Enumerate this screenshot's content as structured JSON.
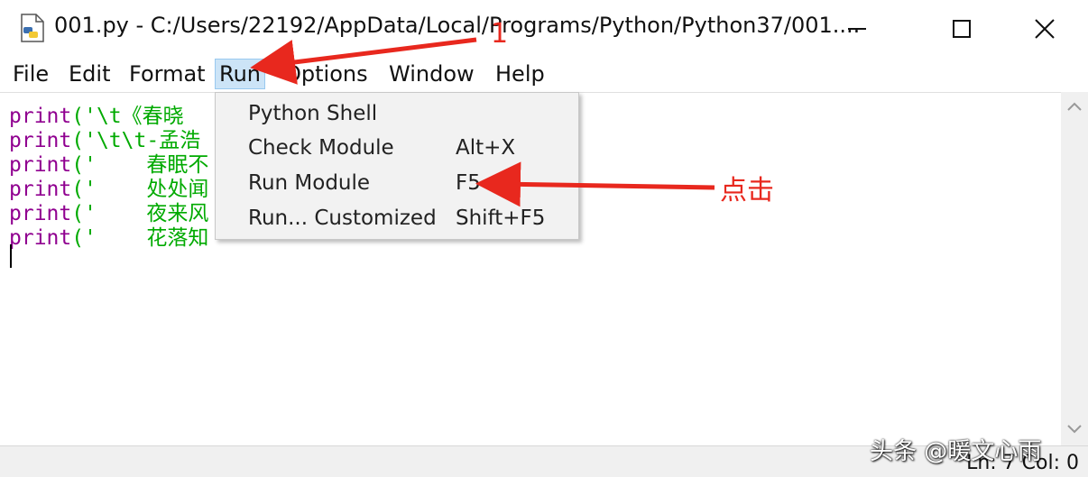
{
  "window": {
    "title": "001.py - C:/Users/22192/AppData/Local/Programs/Python/Python37/001....",
    "controls": {
      "minimize": "minimize-icon",
      "maximize": "maximize-icon",
      "close": "close-icon"
    }
  },
  "menubar": {
    "items": [
      "File",
      "Edit",
      "Format",
      "Run",
      "Options",
      "Window",
      "Help"
    ],
    "active": "Run"
  },
  "editor": {
    "lines": [
      {
        "keyword": "print",
        "text": "('\\t《春晓"
      },
      {
        "keyword": "print",
        "text": "('\\t\\t-孟浩"
      },
      {
        "keyword": "print",
        "text": "('    春眠不"
      },
      {
        "keyword": "print",
        "text": "('    处处闻"
      },
      {
        "keyword": "print",
        "text": "('    夜来风"
      },
      {
        "keyword": "print",
        "text": "('    花落知"
      }
    ]
  },
  "run_menu": {
    "items": [
      {
        "label": "Python Shell",
        "shortcut": ""
      },
      {
        "label": "Check Module",
        "shortcut": "Alt+X"
      },
      {
        "label": "Run Module",
        "shortcut": "F5"
      },
      {
        "label": "Run... Customized",
        "shortcut": "Shift+F5"
      }
    ]
  },
  "annotations": {
    "number": "1",
    "click_label": "点击",
    "color": "#e8281e"
  },
  "statusbar": {
    "text": "Ln: 7  Col: 0"
  },
  "watermark": "头条 @暖文心雨",
  "colors": {
    "keyword": "#900090",
    "string": "#00aa00",
    "menu_highlight": "#cce4f7"
  }
}
